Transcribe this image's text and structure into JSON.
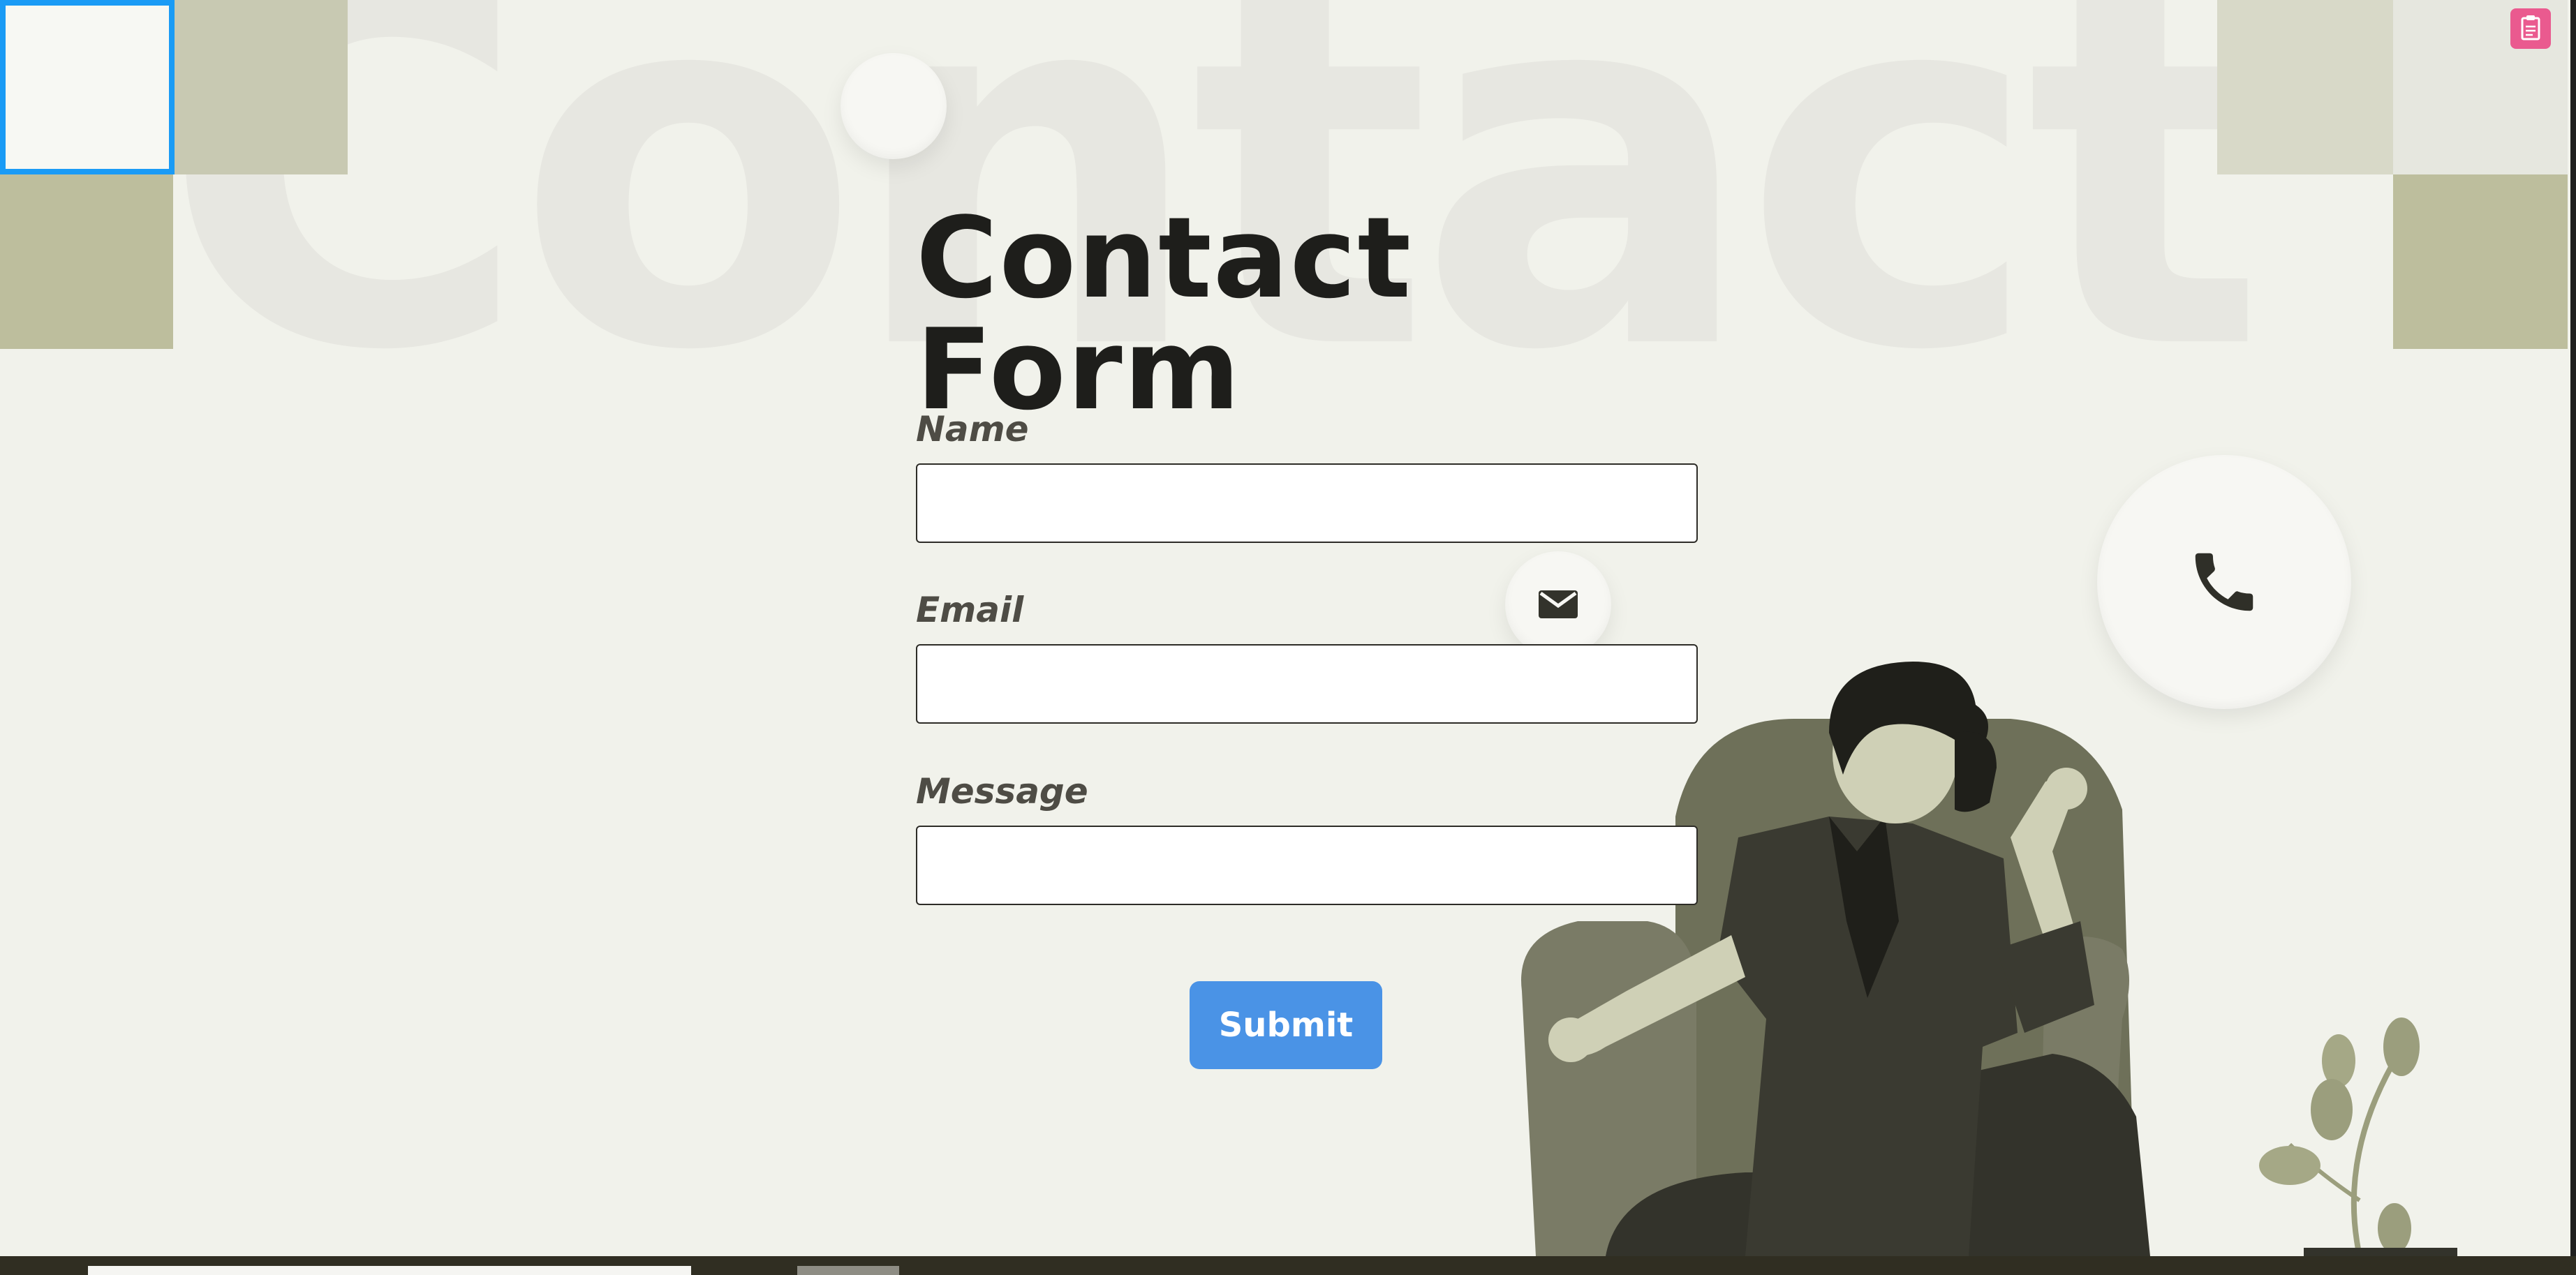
{
  "background_word": "Contact",
  "form": {
    "title": "Contact Form",
    "fields": [
      {
        "label": "Name",
        "value": ""
      },
      {
        "label": "Email",
        "value": ""
      },
      {
        "label": "Message",
        "value": ""
      }
    ],
    "submit_label": "Submit"
  },
  "icons": {
    "email": "envelope-icon",
    "phone": "phone-icon",
    "corner": "clipboard-icon"
  },
  "colors": {
    "background": "#f1f2eb",
    "accent": "#4a93e6",
    "tile_dark": "#bdbe9d",
    "tile_mid": "#c8c9b2",
    "tile_light": "#d8d9c8",
    "selection_border": "#1a9bf5",
    "corner_button": "#ea5a8f"
  }
}
